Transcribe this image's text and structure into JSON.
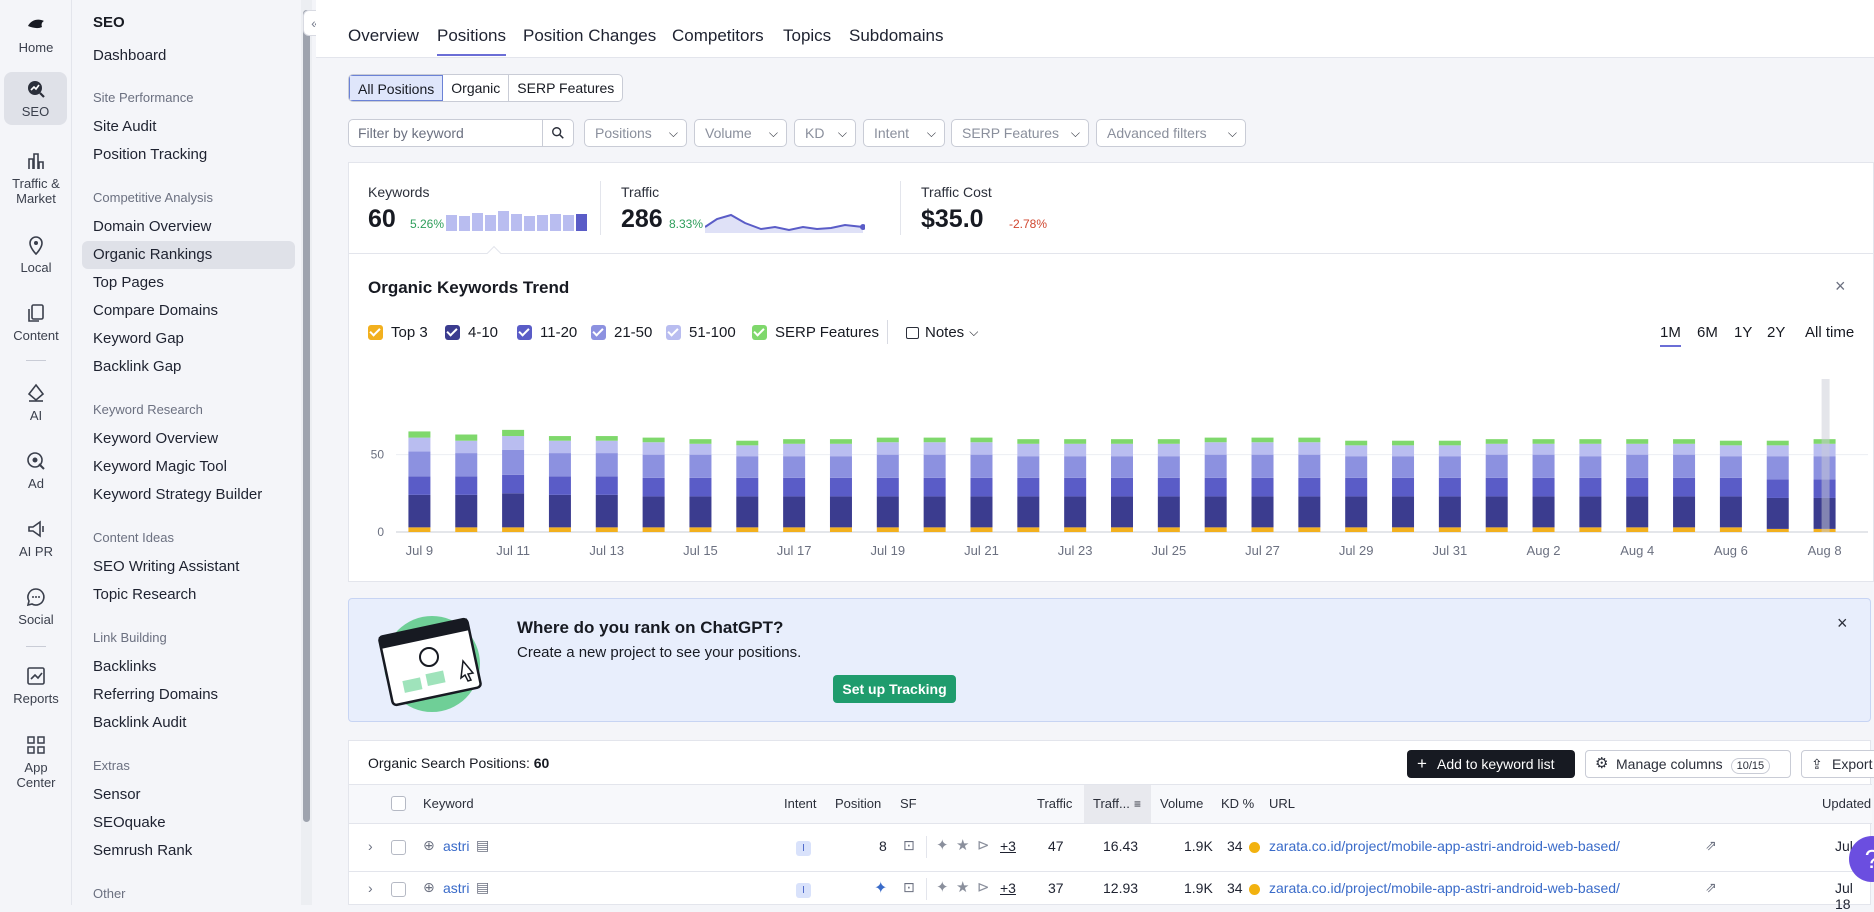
{
  "rail": [
    {
      "label": "Home",
      "icon": "home-icon"
    },
    {
      "label": "SEO",
      "icon": "seo-icon",
      "active": true
    },
    {
      "label": "Traffic & Market",
      "icon": "traffic-market-icon"
    },
    {
      "label": "Local",
      "icon": "location-pin-icon"
    },
    {
      "label": "Content",
      "icon": "content-icon"
    },
    {
      "label": "AI",
      "icon": "ai-icon"
    },
    {
      "label": "Ad",
      "icon": "ad-icon"
    },
    {
      "label": "AI PR",
      "icon": "megaphone-icon"
    },
    {
      "label": "Social",
      "icon": "chat-bubble-icon"
    },
    {
      "label": "Reports",
      "icon": "reports-icon"
    },
    {
      "label": "App Center",
      "icon": "app-grid-icon"
    }
  ],
  "sidebar": {
    "title": "SEO",
    "dashboard": "Dashboard",
    "sections": [
      {
        "title": "Site Performance",
        "items": [
          "Site Audit",
          "Position Tracking"
        ]
      },
      {
        "title": "Competitive Analysis",
        "items": [
          "Domain Overview",
          "Organic Rankings",
          "Top Pages",
          "Compare Domains",
          "Keyword Gap",
          "Backlink Gap"
        ]
      },
      {
        "title": "Keyword Research",
        "items": [
          "Keyword Overview",
          "Keyword Magic Tool",
          "Keyword Strategy Builder"
        ]
      },
      {
        "title": "Content Ideas",
        "items": [
          "SEO Writing Assistant",
          "Topic Research"
        ]
      },
      {
        "title": "Link Building",
        "items": [
          "Backlinks",
          "Referring Domains",
          "Backlink Audit"
        ]
      },
      {
        "title": "Extras",
        "items": [
          "Sensor",
          "SEOquake",
          "Semrush Rank"
        ]
      },
      {
        "title": "Other",
        "items": []
      }
    ],
    "active_item": "Organic Rankings"
  },
  "tabs": [
    "Overview",
    "Positions",
    "Position Changes",
    "Competitors",
    "Topics",
    "Subdomains"
  ],
  "active_tab": "Positions",
  "segments": [
    "All Positions",
    "Organic",
    "SERP Features"
  ],
  "filters": {
    "keyword_placeholder": "Filter by keyword",
    "dropdowns": [
      "Positions",
      "Volume",
      "KD",
      "Intent",
      "SERP Features",
      "Advanced filters"
    ]
  },
  "kpis": {
    "keywords": {
      "label": "Keywords",
      "value": "60",
      "change": "5.26%"
    },
    "traffic": {
      "label": "Traffic",
      "value": "286",
      "change": "8.33%"
    },
    "traffic_cost": {
      "label": "Traffic Cost",
      "value": "$35.0",
      "change": "-2.78%"
    }
  },
  "trend": {
    "title": "Organic Keywords Trend",
    "close": "×",
    "legend": [
      {
        "label": "Top 3",
        "color": "#f2b01e"
      },
      {
        "label": "4-10",
        "color": "#3b3c8f"
      },
      {
        "label": "11-20",
        "color": "#5a5cc7"
      },
      {
        "label": "21-50",
        "color": "#8c91e0"
      },
      {
        "label": "51-100",
        "color": "#b9bdf0"
      },
      {
        "label": "SERP Features",
        "color": "#7fd86c"
      }
    ],
    "notes_label": "Notes",
    "ranges": [
      "1M",
      "6M",
      "1Y",
      "2Y",
      "All time"
    ],
    "active_range": "1M"
  },
  "chart_data": {
    "type": "bar",
    "stacked": true,
    "x": [
      "Jul 9",
      "Jul 10",
      "Jul 11",
      "Jul 12",
      "Jul 13",
      "Jul 14",
      "Jul 15",
      "Jul 16",
      "Jul 17",
      "Jul 18",
      "Jul 19",
      "Jul 20",
      "Jul 21",
      "Jul 22",
      "Jul 23",
      "Jul 24",
      "Jul 25",
      "Jul 26",
      "Jul 27",
      "Jul 28",
      "Jul 29",
      "Jul 30",
      "Jul 31",
      "Aug 1",
      "Aug 2",
      "Aug 3",
      "Aug 4",
      "Aug 5",
      "Aug 6",
      "Aug 7",
      "Aug 8"
    ],
    "x_tick_labels": [
      "Jul 9",
      "Jul 11",
      "Jul 13",
      "Jul 15",
      "Jul 17",
      "Jul 19",
      "Jul 21",
      "Jul 23",
      "Jul 25",
      "Jul 27",
      "Jul 29",
      "Jul 31",
      "Aug 2",
      "Aug 4",
      "Aug 6",
      "Aug 8"
    ],
    "y_ticks": [
      0,
      50
    ],
    "ylim": [
      0,
      95
    ],
    "series": [
      {
        "name": "Top 3",
        "color": "#f2b01e",
        "values": [
          3,
          3,
          3,
          3,
          3,
          3,
          3,
          3,
          3,
          3,
          3,
          3,
          3,
          3,
          3,
          3,
          3,
          3,
          3,
          3,
          3,
          3,
          3,
          3,
          3,
          3,
          3,
          3,
          3,
          2,
          2
        ]
      },
      {
        "name": "4-10",
        "color": "#3b3c8f",
        "values": [
          21,
          21,
          22,
          21,
          21,
          20,
          20,
          20,
          20,
          20,
          20,
          20,
          20,
          20,
          20,
          20,
          20,
          20,
          20,
          20,
          20,
          20,
          20,
          20,
          20,
          20,
          20,
          20,
          20,
          20,
          20
        ]
      },
      {
        "name": "11-20",
        "color": "#5a5cc7",
        "values": [
          12,
          12,
          12,
          12,
          12,
          12,
          12,
          12,
          12,
          12,
          12,
          12,
          12,
          12,
          12,
          12,
          12,
          12,
          12,
          12,
          12,
          12,
          12,
          12,
          12,
          12,
          12,
          12,
          12,
          12,
          12
        ]
      },
      {
        "name": "21-50",
        "color": "#8c91e0",
        "values": [
          16,
          15,
          16,
          15,
          15,
          15,
          15,
          14,
          14,
          14,
          15,
          15,
          15,
          14,
          14,
          14,
          14,
          15,
          15,
          15,
          14,
          14,
          14,
          15,
          15,
          14,
          15,
          15,
          14,
          15,
          15
        ]
      },
      {
        "name": "51-100",
        "color": "#b9bdf0",
        "values": [
          9,
          8,
          9,
          8,
          8,
          8,
          7,
          7,
          8,
          8,
          8,
          8,
          8,
          8,
          8,
          8,
          8,
          8,
          8,
          8,
          7,
          7,
          7,
          7,
          7,
          8,
          7,
          7,
          7,
          7,
          8
        ]
      },
      {
        "name": "SERP Features",
        "color": "#7fd86c",
        "values": [
          4,
          4,
          4,
          3,
          3,
          3,
          3,
          3,
          3,
          3,
          3,
          3,
          3,
          3,
          3,
          3,
          3,
          3,
          3,
          3,
          3,
          3,
          3,
          3,
          3,
          3,
          3,
          3,
          3,
          3,
          3
        ]
      }
    ]
  },
  "promo": {
    "title": "Where do you rank on ChatGPT?",
    "text": "Create a new project to see your positions.",
    "button": "Set up Tracking",
    "close": "×"
  },
  "table": {
    "title_prefix": "Organic Search Positions:",
    "count": "60",
    "add_button": "Add to keyword list",
    "manage_columns": "Manage columns",
    "columns_badge": "10/15",
    "export": "Export",
    "headers": [
      "Keyword",
      "Intent",
      "Position",
      "SF",
      "Traffic",
      "Traff...",
      "Volume",
      "KD %",
      "URL",
      "Updated"
    ],
    "rows": [
      {
        "keyword": "astri",
        "intent": "I",
        "position": "8",
        "sf_more": "+3",
        "traffic": "47",
        "traffic_pct": "16.43",
        "volume": "1.9K",
        "kd": "34",
        "url": "zarata.co.id/project/mobile-app-astri-android-web-based/",
        "updated": "Jul 1"
      },
      {
        "keyword": "astri",
        "intent": "I",
        "position": "",
        "sf_more": "+3",
        "traffic": "37",
        "traffic_pct": "12.93",
        "volume": "1.9K",
        "kd": "34",
        "url": "zarata.co.id/project/mobile-app-astri-android-web-based/",
        "updated": "Jul 18"
      }
    ]
  }
}
